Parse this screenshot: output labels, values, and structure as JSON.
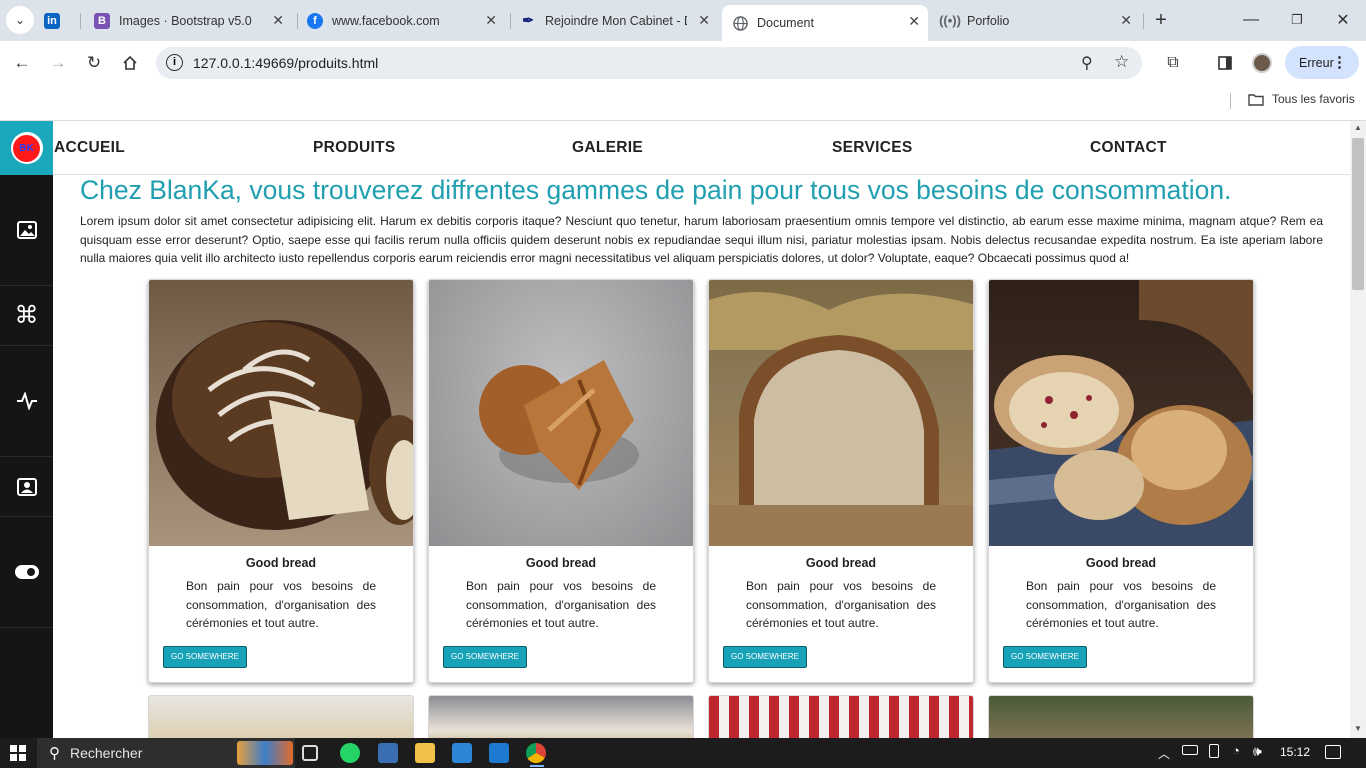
{
  "browser": {
    "tabs": [
      {
        "title": "",
        "icon": "linkedin-icon",
        "color": "#0a66c2"
      },
      {
        "title": "Images · Bootstrap v5.0",
        "icon": "bootstrap-icon",
        "color": "#7952b3"
      },
      {
        "title": "www.facebook.com",
        "icon": "facebook-icon",
        "color": "#1877f2"
      },
      {
        "title": "Rejoindre Mon Cabinet - D",
        "icon": "feather-icon",
        "color": "#1a237e"
      },
      {
        "title": "Document",
        "icon": "globe-icon",
        "color": "#5f6368",
        "active": true
      },
      {
        "title": "Porfolio",
        "icon": "broadcast-icon",
        "color": "#5f6368"
      }
    ],
    "url": "127.0.0.1:49669/produits.html",
    "profile_status": "Erreur",
    "bookmarks_label": "Tous les favoris"
  },
  "site": {
    "logo_text": "BK",
    "nav": [
      "ACCUEIL",
      "PRODUITS",
      "GALERIE",
      "SERVICES",
      "CONTACT"
    ],
    "sidebar_icons": [
      "gallery-icon",
      "command-icon",
      "activity-icon",
      "contact-card-icon",
      "toggle-icon"
    ],
    "heading": "Chez BlanKa, vous trouverez diffrentes gammes de pain pour tous vos besoins de consommation.",
    "intro": "Lorem ipsum dolor sit amet consectetur adipisicing elit. Harum ex debitis corporis itaque? Nesciunt quo tenetur, harum laboriosam praesentium omnis tempore vel distinctio, ab earum esse maxime minima, magnam atque? Rem ea quisquam esse error deserunt? Optio, saepe esse qui facilis rerum nulla officiis quidem deserunt nobis ex repudiandae sequi illum nisi, pariatur molestias ipsam. Nobis delectus recusandae expedita nostrum. Ea iste aperiam labore nulla maiores quia velit illo architecto iusto repellendus corporis earum reiciendis error magni necessitatibus vel aliquam perspiciatis dolores, ut dolor? Voluptate, eaque? Obcaecati possimus quod a!",
    "cards": [
      {
        "title": "Good bread",
        "text": "Bon pain pour vos besoins de consommation, d'organisation des cérémonies et tout autre.",
        "button": "GO SOMEWHERE"
      },
      {
        "title": "Good bread",
        "text": "Bon pain pour vos besoins de consommation, d'organisation des cérémonies et tout autre.",
        "button": "GO SOMEWHERE"
      },
      {
        "title": "Good bread",
        "text": "Bon pain pour vos besoins de consommation, d'organisation des cérémonies et tout autre.",
        "button": "GO SOMEWHERE"
      },
      {
        "title": "Good bread",
        "text": "Bon pain pour vos besoins de consommation, d'organisation des cérémonies et tout autre.",
        "button": "GO SOMEWHERE"
      }
    ]
  },
  "taskbar": {
    "search_placeholder": "Rechercher",
    "clock": "15:12"
  },
  "colors": {
    "accent": "#1f9fb0",
    "button": "#17a2b8",
    "sidebar": "#151515"
  }
}
